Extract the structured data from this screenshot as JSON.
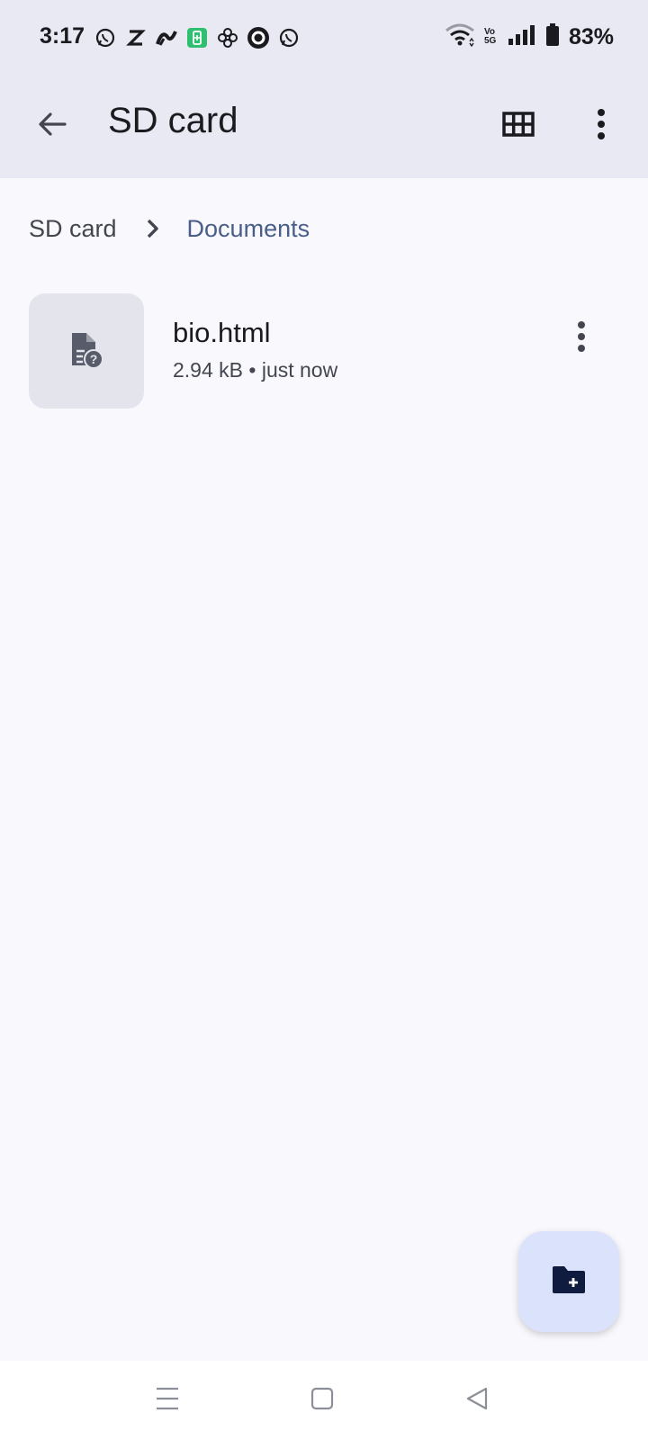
{
  "status_bar": {
    "time": "3:17",
    "left_icons": [
      "whatsapp-icon",
      "z-app-icon",
      "swirl-app-icon",
      "battery-saver-icon",
      "pinwheel-icon",
      "circle-app-icon",
      "whatsapp-icon"
    ],
    "right_icons": [
      "wifi-icon",
      "volte-icon",
      "signal-icon",
      "battery-icon"
    ],
    "volte_label": "Vo 5G",
    "battery_percent": "83%"
  },
  "app_bar": {
    "title": "SD card",
    "back_icon": "arrow-back-icon",
    "grid_icon": "grid-view-icon",
    "more_icon": "more-vert-icon"
  },
  "breadcrumb": {
    "root": "SD card",
    "separator_icon": "chevron-right-icon",
    "current": "Documents"
  },
  "files": [
    {
      "name": "bio.html",
      "meta": "2.94 kB • just now",
      "icon": "unknown-file-icon"
    }
  ],
  "fab": {
    "icon": "create-folder-icon"
  },
  "nav_bar": {
    "icons": [
      "menu-icon",
      "home-icon",
      "back-icon"
    ]
  },
  "colors": {
    "app_bar_bg": "#e9e9f3",
    "page_bg": "#f8f8fd",
    "accent_text": "#4a5e8a",
    "fab_bg": "#dbe2fb"
  }
}
